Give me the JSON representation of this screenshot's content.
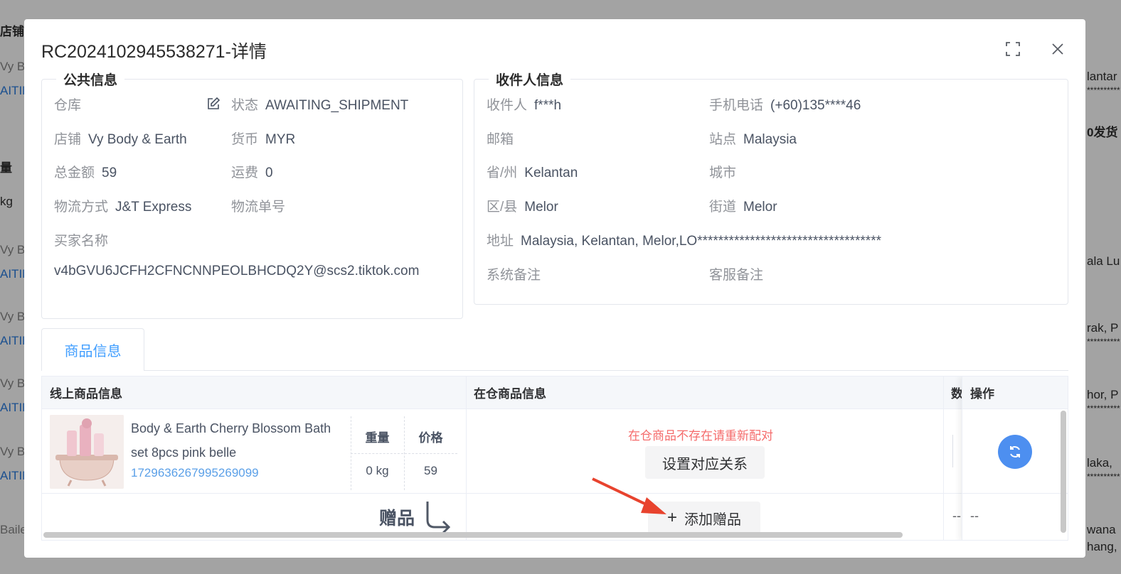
{
  "background": {
    "fragments": [
      "店铺/",
      "Vy B",
      "AITIN",
      "量",
      "kg",
      "Vy B",
      "AITIN",
      "Vy B",
      "AITIN",
      "Vy B",
      "AITIN",
      "Vy B",
      "AITIN",
      "Baile"
    ],
    "right_fragments": [
      "lantar",
      "**********",
      "0发货",
      "ala Lu",
      "rak, P",
      "**********",
      "hor, P",
      "**********",
      "laka,",
      "**********",
      "wana",
      "hang,"
    ]
  },
  "modal": {
    "title": "RC2024102945538271-详情",
    "public_info": {
      "legend": "公共信息",
      "warehouse_label": "仓库",
      "status_label": "状态",
      "status_value": "AWAITING_SHIPMENT",
      "shop_label": "店铺",
      "shop_value": "Vy Body & Earth",
      "currency_label": "货币",
      "currency_value": "MYR",
      "total_label": "总金额",
      "total_value": "59",
      "freight_label": "运费",
      "freight_value": "0",
      "logistics_label": "物流方式",
      "logistics_value": "J&T Express",
      "tracking_label": "物流单号",
      "buyer_label": "买家名称",
      "buyer_value": "v4bGVU6JCFH2CFNCNNPEOLBHCDQ2Y@scs2.tiktok.com"
    },
    "recipient_info": {
      "legend": "收件人信息",
      "recipient_label": "收件人",
      "recipient_value": "f***h",
      "mobile_label": "手机电话",
      "mobile_value": "(+60)135****46",
      "email_label": "邮箱",
      "site_label": "站点",
      "site_value": "Malaysia",
      "province_label": "省/州",
      "province_value": "Kelantan",
      "city_label": "城市",
      "district_label": "区/县",
      "district_value": "Melor",
      "street_label": "街道",
      "street_value": "Melor",
      "address_label": "地址",
      "address_value": "Malaysia, Kelantan, Melor,LO***********************************",
      "system_note_label": "系统备注",
      "cs_note_label": "客服备注"
    },
    "tab_label": "商品信息",
    "table": {
      "col_online": "线上商品信息",
      "col_warehouse": "在仓商品信息",
      "col_qty": "数",
      "col_ops": "操作",
      "product_name": "Body & Earth Cherry Blossom Bath set 8pcs pink belle",
      "product_id": "1729636267995269099",
      "weight_label": "重量",
      "price_label": "价格",
      "weight_value": "0 kg",
      "price_value": "59",
      "warning": "在仓商品不存在请重新配对",
      "set_mapping_button": "设置对应关系",
      "gift_label": "赠品",
      "add_gift_button": "添加赠品",
      "dash_qty": "--",
      "dash_ops": "--"
    }
  }
}
